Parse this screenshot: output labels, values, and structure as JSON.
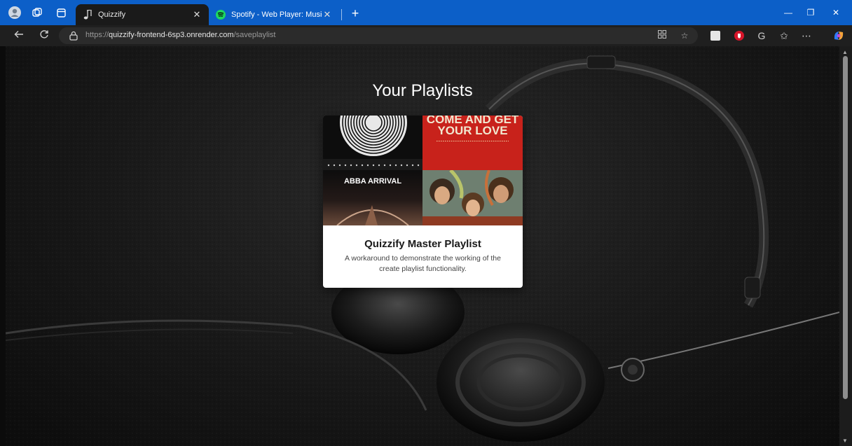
{
  "browser": {
    "tabs": [
      {
        "label": "Quizzify",
        "active": true,
        "favicon": "music-note-icon"
      },
      {
        "label": "Spotify - Web Player: Music for everyone",
        "active": false,
        "favicon": "spotify-icon"
      }
    ],
    "new_tab_label": "+",
    "window_controls": {
      "minimize": "—",
      "restore": "❐",
      "close": "✕"
    },
    "address": {
      "scheme": "https://",
      "host": "quizzify-frontend-6sp3.onrender.com",
      "path": "/saveplaylist"
    },
    "colors": {
      "titlebar": "#0c5fc8",
      "toolbar": "#1f1f1f"
    }
  },
  "page": {
    "title": "Your Playlists",
    "playlists": [
      {
        "name": "Quizzify Master Playlist",
        "description": "A workaround to demonstrate the working of the create playlist functionality.",
        "covers": {
          "top_right_line1": "COME AND GET",
          "top_right_line2": "YOUR LOVE",
          "bottom_left_title": "ABBA  ARRIVAL"
        }
      }
    ]
  }
}
